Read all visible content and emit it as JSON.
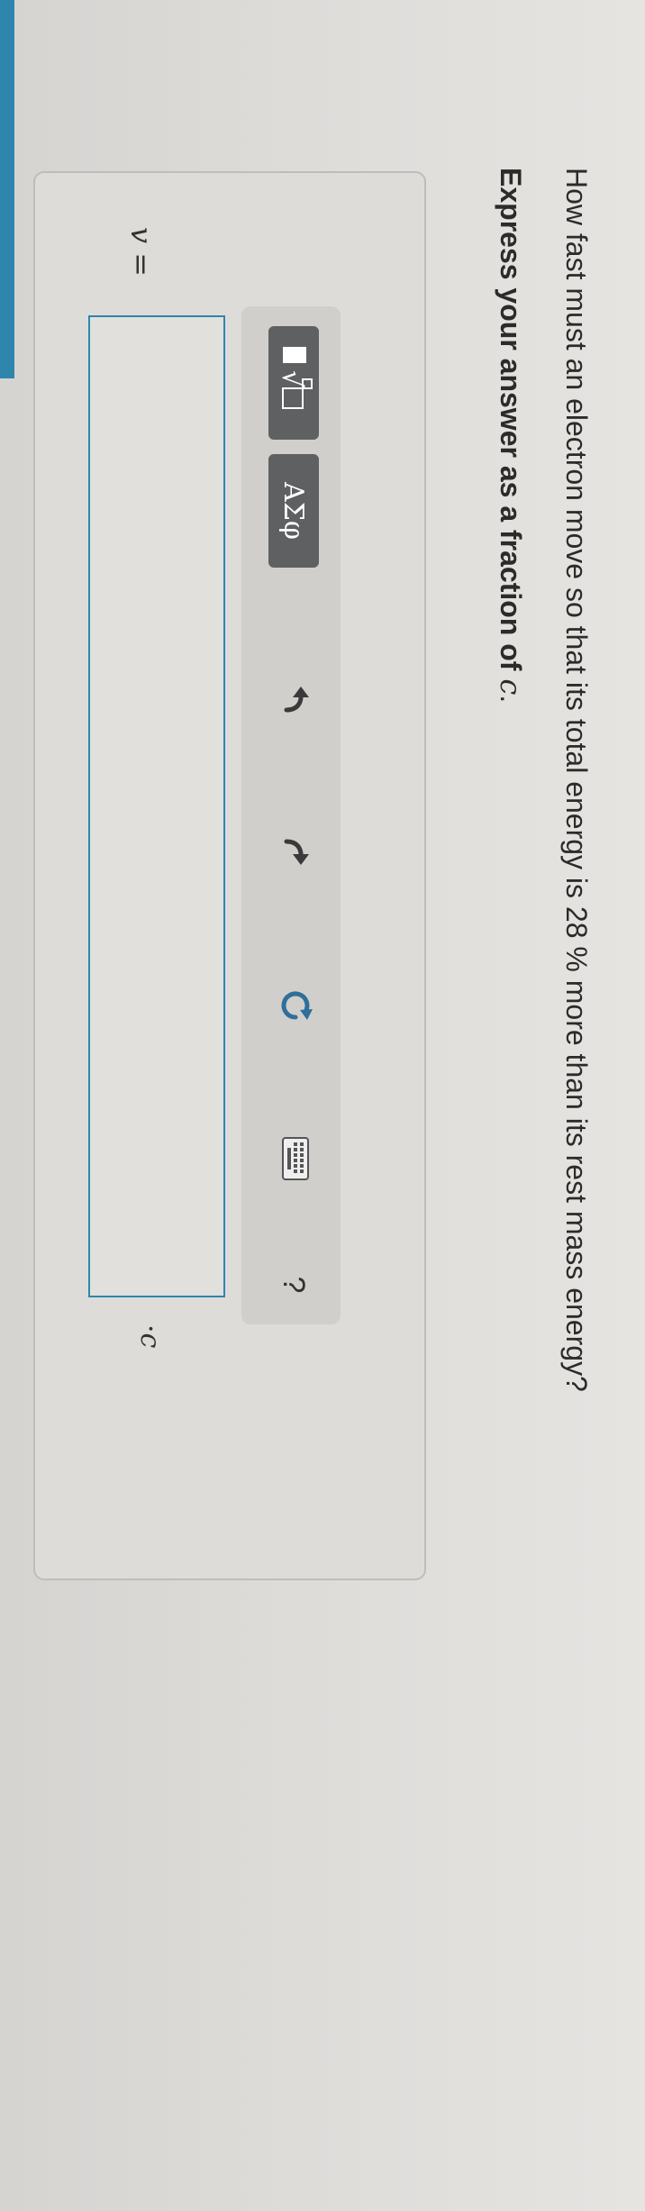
{
  "question": {
    "text": "How fast must an electron move so that its total energy is 28 % more than its rest mass energy?"
  },
  "instruction": {
    "bold_text": "Express your answer as a fraction of",
    "variable": "c",
    "period": "."
  },
  "toolbar": {
    "templates_icon": "fraction-sqrt-template-icon",
    "greek_label": "ΑΣφ",
    "undo_icon": "undo-arrow-icon",
    "redo_icon": "redo-arrow-icon",
    "reset_icon": "reset-circular-arrow-icon",
    "keyboard_icon": "keyboard-icon",
    "help_label": "?"
  },
  "answer": {
    "variable": "v",
    "equals": "=",
    "value": "",
    "unit_dot": "·",
    "unit": "c"
  },
  "colors": {
    "accent": "#2e86ad",
    "button_dark": "#5f6062",
    "background": "#dedcd9"
  }
}
